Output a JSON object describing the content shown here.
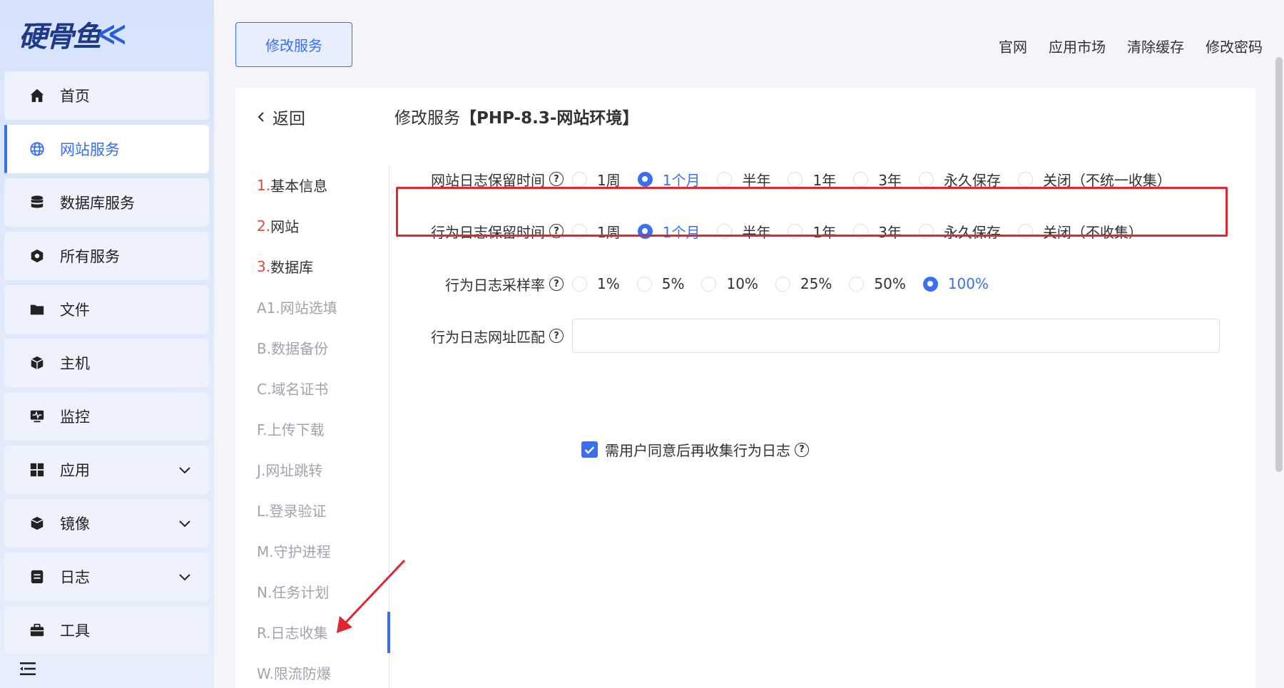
{
  "logo": {
    "text": "硬骨鱼",
    "fish": "≪"
  },
  "sidebar": {
    "items": [
      {
        "label": "首页",
        "icon": "home-icon",
        "active": false,
        "chevron": false
      },
      {
        "label": "网站服务",
        "icon": "globe-icon",
        "active": true,
        "chevron": false
      },
      {
        "label": "数据库服务",
        "icon": "database-icon",
        "active": false,
        "chevron": false
      },
      {
        "label": "所有服务",
        "icon": "services-icon",
        "active": false,
        "chevron": false
      },
      {
        "label": "文件",
        "icon": "folder-icon",
        "active": false,
        "chevron": false
      },
      {
        "label": "主机",
        "icon": "host-icon",
        "active": false,
        "chevron": false
      },
      {
        "label": "监控",
        "icon": "monitor-icon",
        "active": false,
        "chevron": false
      },
      {
        "label": "应用",
        "icon": "apps-icon",
        "active": false,
        "chevron": true
      },
      {
        "label": "镜像",
        "icon": "image-icon",
        "active": false,
        "chevron": true
      },
      {
        "label": "日志",
        "icon": "log-icon",
        "active": false,
        "chevron": true
      },
      {
        "label": "工具",
        "icon": "toolbox-icon",
        "active": false,
        "chevron": false
      }
    ]
  },
  "header": {
    "tab_label": "修改服务",
    "links": [
      "官网",
      "应用市场",
      "清除缓存",
      "修改密码"
    ]
  },
  "page": {
    "back_label": "返回",
    "title_prefix": "修改服务",
    "title_bracket": "【PHP-8.3-网站环境】"
  },
  "steps": [
    {
      "num": "1.",
      "label": "基本信息",
      "style": "dark"
    },
    {
      "num": "2.",
      "label": "网站",
      "style": "dark"
    },
    {
      "num": "3.",
      "label": "数据库",
      "style": "dark"
    },
    {
      "num": "",
      "label": "A1.网站选填",
      "style": "muted"
    },
    {
      "num": "",
      "label": "B.数据备份",
      "style": "muted"
    },
    {
      "num": "",
      "label": "C.域名证书",
      "style": "muted"
    },
    {
      "num": "",
      "label": "F.上传下载",
      "style": "muted"
    },
    {
      "num": "",
      "label": "J.网址跳转",
      "style": "muted"
    },
    {
      "num": "",
      "label": "L.登录验证",
      "style": "muted"
    },
    {
      "num": "",
      "label": "M.守护进程",
      "style": "muted"
    },
    {
      "num": "",
      "label": "N.任务计划",
      "style": "muted"
    },
    {
      "num": "",
      "label": "R.日志收集",
      "style": "muted"
    },
    {
      "num": "",
      "label": "W.限流防爆",
      "style": "muted"
    }
  ],
  "form": {
    "site_log_retention": {
      "label": "网站日志保留时间",
      "options": [
        "1周",
        "1个月",
        "半年",
        "1年",
        "3年",
        "永久保存",
        "关闭（不统一收集）"
      ],
      "selected": "1个月"
    },
    "behavior_log_retention": {
      "label": "行为日志保留时间",
      "options": [
        "1周",
        "1个月",
        "半年",
        "1年",
        "3年",
        "永久保存",
        "关闭（不收集）"
      ],
      "selected": "1个月"
    },
    "behavior_log_sampling": {
      "label": "行为日志采样率",
      "options": [
        "1%",
        "5%",
        "10%",
        "25%",
        "50%",
        "100%"
      ],
      "selected": "100%"
    },
    "behavior_log_url_match": {
      "label": "行为日志网址匹配",
      "value": "",
      "placeholder": ""
    },
    "consent_checkbox": {
      "label": "需用户同意后再收集行为日志",
      "checked": true
    }
  },
  "colors": {
    "accent": "#3a6ff2",
    "highlight": "#e0262f",
    "step_number": "#e04a3a"
  }
}
